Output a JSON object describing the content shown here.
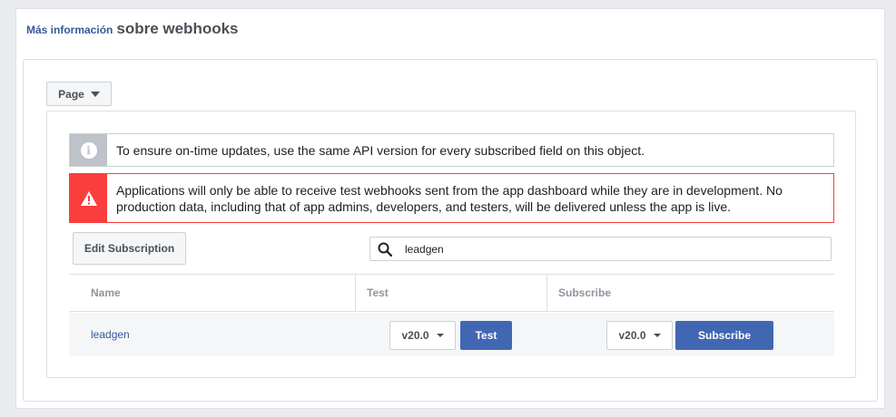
{
  "header": {
    "link_text": "Más información",
    "title": "sobre webhooks"
  },
  "object_selector": {
    "value": "Page",
    "icon": "caret-down-icon"
  },
  "notices": {
    "info": {
      "icon": "info-icon",
      "text": "To ensure on-time updates, use the same API version for every subscribed field on this object."
    },
    "error": {
      "icon": "warning-icon",
      "text": "Applications will only be able to receive test webhooks sent from the app dashboard while they are in development. No production data, including that of app admins, developers, and testers, will be delivered unless the app is live."
    }
  },
  "toolbar": {
    "edit_label": "Edit Subscription",
    "search_value": "leadgen",
    "search_icon": "search-icon"
  },
  "table": {
    "columns": [
      "Name",
      "Test",
      "Subscribe"
    ],
    "rows": [
      {
        "name": "leadgen",
        "test_version": "v20.0",
        "test_label": "Test",
        "subscribe_version": "v20.0",
        "subscribe_label": "Subscribe"
      }
    ]
  },
  "colors": {
    "accent": "#4267b2",
    "link": "#365899",
    "error": "#fa3e3e",
    "info": "#bec2c9",
    "page_bg": "#e9ebee"
  }
}
